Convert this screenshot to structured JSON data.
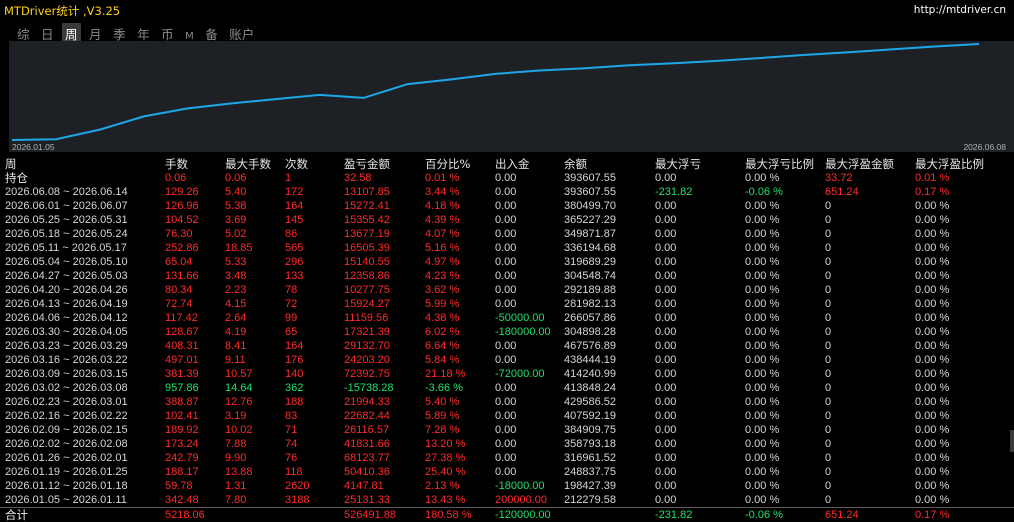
{
  "app": {
    "title": "MTDriver统计 ,V3.25",
    "link": "http://mtdriver.cn"
  },
  "tabs": [
    {
      "label": "综",
      "active": false
    },
    {
      "label": "日",
      "active": false
    },
    {
      "label": "周",
      "active": true
    },
    {
      "label": "月",
      "active": false
    },
    {
      "label": "季",
      "active": false
    },
    {
      "label": "年",
      "active": false
    },
    {
      "label": "币",
      "active": false
    },
    {
      "label": "M",
      "active": false
    },
    {
      "label": "备",
      "active": false
    },
    {
      "label": "账户",
      "active": false
    }
  ],
  "chart_data": {
    "type": "line",
    "x_start_label": "2026.01.05",
    "x_end_label": "2026.06.08",
    "line_color": "#1ea7e8",
    "background": "#1d2126",
    "grid": false,
    "x": [
      "2026.01.05",
      "2026.01.12",
      "2026.01.19",
      "2026.01.26",
      "2026.02.02",
      "2026.02.09",
      "2026.02.16",
      "2026.02.23",
      "2026.03.02",
      "2026.03.09",
      "2026.03.16",
      "2026.03.23",
      "2026.03.30",
      "2026.04.06",
      "2026.04.13",
      "2026.04.20",
      "2026.04.27",
      "2026.05.04",
      "2026.05.11",
      "2026.05.18",
      "2026.05.25",
      "2026.06.01",
      "2026.06.08"
    ],
    "values": [
      25131.33,
      29278.14,
      79688.5,
      148512.03,
      190353.99,
      216470.56,
      238953.4,
      260947.73,
      245209.45,
      317602.15,
      341805.15,
      370937.85,
      388259.24,
      399419.8,
      415344.07,
      425621.82,
      437980.68,
      453121.23,
      469626.42,
      483303.61,
      498659.03,
      513931.44,
      527039.29
    ]
  },
  "table": {
    "headers": [
      "周",
      "手数",
      "最大手数",
      "次数",
      "盈亏金额",
      "百分比%",
      "出入金",
      "余额",
      "最大浮亏",
      "最大浮亏比例",
      "最大浮盈金额",
      "最大浮盈比例"
    ],
    "hold": {
      "c": [
        "持仓",
        "0.06",
        "0.06",
        "1",
        "32.58",
        "0.01 %",
        "0.00",
        "393607.55",
        "0.00",
        "0.00 %",
        "33.72",
        "0.01 %"
      ],
      "k": [
        "w",
        "r",
        "r",
        "r",
        "r",
        "r",
        "g",
        "g",
        "g",
        "g",
        "r",
        "r"
      ]
    },
    "rows": [
      {
        "c": [
          "2026.06.08 ~ 2026.06.14",
          "129.26",
          "5.40",
          "172",
          "13107.85",
          "3.44 %",
          "0.00",
          "393607.55",
          "-231.82",
          "-0.06 %",
          "651.24",
          "0.17 %"
        ],
        "k": [
          "g",
          "r",
          "r",
          "r",
          "r",
          "r",
          "g",
          "g",
          "n",
          "n",
          "r",
          "r"
        ]
      },
      {
        "c": [
          "2026.06.01 ~ 2026.06.07",
          "126.96",
          "5.38",
          "164",
          "15272.41",
          "4.18 %",
          "0.00",
          "380499.70",
          "0.00",
          "0.00 %",
          "0",
          "0.00 %"
        ],
        "k": [
          "g",
          "r",
          "r",
          "r",
          "r",
          "r",
          "g",
          "g",
          "g",
          "g",
          "g",
          "g"
        ]
      },
      {
        "c": [
          "2026.05.25 ~ 2026.05.31",
          "104.52",
          "3.69",
          "145",
          "15355.42",
          "4.39 %",
          "0.00",
          "365227.29",
          "0.00",
          "0.00 %",
          "0",
          "0.00 %"
        ],
        "k": [
          "g",
          "r",
          "r",
          "r",
          "r",
          "r",
          "g",
          "g",
          "g",
          "g",
          "g",
          "g"
        ]
      },
      {
        "c": [
          "2026.05.18 ~ 2026.05.24",
          "76.30",
          "5.02",
          "86",
          "13677.19",
          "4.07 %",
          "0.00",
          "349871.87",
          "0.00",
          "0.00 %",
          "0",
          "0.00 %"
        ],
        "k": [
          "g",
          "r",
          "r",
          "r",
          "r",
          "r",
          "g",
          "g",
          "g",
          "g",
          "g",
          "g"
        ]
      },
      {
        "c": [
          "2026.05.11 ~ 2026.05.17",
          "252.86",
          "18.85",
          "565",
          "16505.39",
          "5.16 %",
          "0.00",
          "336194.68",
          "0.00",
          "0.00 %",
          "0",
          "0.00 %"
        ],
        "k": [
          "g",
          "r",
          "r",
          "r",
          "r",
          "r",
          "g",
          "g",
          "g",
          "g",
          "g",
          "g"
        ]
      },
      {
        "c": [
          "2026.05.04 ~ 2026.05.10",
          "65.04",
          "5.33",
          "296",
          "15140.55",
          "4.97 %",
          "0.00",
          "319689.29",
          "0.00",
          "0.00 %",
          "0",
          "0.00 %"
        ],
        "k": [
          "g",
          "r",
          "r",
          "r",
          "r",
          "r",
          "g",
          "g",
          "g",
          "g",
          "g",
          "g"
        ]
      },
      {
        "c": [
          "2026.04.27 ~ 2026.05.03",
          "131.66",
          "3.48",
          "133",
          "12358.86",
          "4.23 %",
          "0.00",
          "304548.74",
          "0.00",
          "0.00 %",
          "0",
          "0.00 %"
        ],
        "k": [
          "g",
          "r",
          "r",
          "r",
          "r",
          "r",
          "g",
          "g",
          "g",
          "g",
          "g",
          "g"
        ]
      },
      {
        "c": [
          "2026.04.20 ~ 2026.04.26",
          "80.34",
          "2.23",
          "78",
          "10277.75",
          "3.62 %",
          "0.00",
          "292189.88",
          "0.00",
          "0.00 %",
          "0",
          "0.00 %"
        ],
        "k": [
          "g",
          "r",
          "r",
          "r",
          "r",
          "r",
          "g",
          "g",
          "g",
          "g",
          "g",
          "g"
        ]
      },
      {
        "c": [
          "2026.04.13 ~ 2026.04.19",
          "72.74",
          "4.15",
          "72",
          "15924.27",
          "5.99 %",
          "0.00",
          "281982.13",
          "0.00",
          "0.00 %",
          "0",
          "0.00 %"
        ],
        "k": [
          "g",
          "r",
          "r",
          "r",
          "r",
          "r",
          "g",
          "g",
          "g",
          "g",
          "g",
          "g"
        ]
      },
      {
        "c": [
          "2026.04.06 ~ 2026.04.12",
          "117.42",
          "2.64",
          "99",
          "11159.56",
          "4.38 %",
          "-50000.00",
          "266057.86",
          "0.00",
          "0.00 %",
          "0",
          "0.00 %"
        ],
        "k": [
          "g",
          "r",
          "r",
          "r",
          "r",
          "r",
          "n",
          "g",
          "g",
          "g",
          "g",
          "g"
        ]
      },
      {
        "c": [
          "2026.03.30 ~ 2026.04.05",
          "128.67",
          "4.19",
          "65",
          "17321.39",
          "6.02 %",
          "-180000.00",
          "304898.28",
          "0.00",
          "0.00 %",
          "0",
          "0.00 %"
        ],
        "k": [
          "g",
          "r",
          "r",
          "r",
          "r",
          "r",
          "n",
          "g",
          "g",
          "g",
          "g",
          "g"
        ]
      },
      {
        "c": [
          "2026.03.23 ~ 2026.03.29",
          "408.31",
          "8.41",
          "164",
          "29132.70",
          "6.64 %",
          "0.00",
          "467576.89",
          "0.00",
          "0.00 %",
          "0",
          "0.00 %"
        ],
        "k": [
          "g",
          "r",
          "r",
          "r",
          "r",
          "r",
          "g",
          "g",
          "g",
          "g",
          "g",
          "g"
        ]
      },
      {
        "c": [
          "2026.03.16 ~ 2026.03.22",
          "497.01",
          "9.11",
          "176",
          "24203.20",
          "5.84 %",
          "0.00",
          "438444.19",
          "0.00",
          "0.00 %",
          "0",
          "0.00 %"
        ],
        "k": [
          "g",
          "r",
          "r",
          "r",
          "r",
          "r",
          "g",
          "g",
          "g",
          "g",
          "g",
          "g"
        ]
      },
      {
        "c": [
          "2026.03.09 ~ 2026.03.15",
          "381.39",
          "10.57",
          "140",
          "72392.75",
          "21.18 %",
          "-72000.00",
          "414240.99",
          "0.00",
          "0.00 %",
          "0",
          "0.00 %"
        ],
        "k": [
          "g",
          "r",
          "r",
          "r",
          "r",
          "r",
          "n",
          "g",
          "g",
          "g",
          "g",
          "g"
        ]
      },
      {
        "c": [
          "2026.03.02 ~ 2026.03.08",
          "957.86",
          "14.64",
          "362",
          "-15738.28",
          "-3.66 %",
          "0.00",
          "413848.24",
          "0.00",
          "0.00 %",
          "0",
          "0.00 %"
        ],
        "k": [
          "g",
          "n",
          "n",
          "n",
          "n",
          "n",
          "g",
          "g",
          "g",
          "g",
          "g",
          "g"
        ]
      },
      {
        "c": [
          "2026.02.23 ~ 2026.03.01",
          "388.87",
          "12.76",
          "188",
          "21994.33",
          "5.40 %",
          "0.00",
          "429586.52",
          "0.00",
          "0.00 %",
          "0",
          "0.00 %"
        ],
        "k": [
          "g",
          "r",
          "r",
          "r",
          "r",
          "r",
          "g",
          "g",
          "g",
          "g",
          "g",
          "g"
        ]
      },
      {
        "c": [
          "2026.02.16 ~ 2026.02.22",
          "102.41",
          "3.19",
          "83",
          "22682.44",
          "5.89 %",
          "0.00",
          "407592.19",
          "0.00",
          "0.00 %",
          "0",
          "0.00 %"
        ],
        "k": [
          "g",
          "r",
          "r",
          "r",
          "r",
          "r",
          "g",
          "g",
          "g",
          "g",
          "g",
          "g"
        ]
      },
      {
        "c": [
          "2026.02.09 ~ 2026.02.15",
          "189.92",
          "10.02",
          "71",
          "26116.57",
          "7.28 %",
          "0.00",
          "384909.75",
          "0.00",
          "0.00 %",
          "0",
          "0.00 %"
        ],
        "k": [
          "g",
          "r",
          "r",
          "r",
          "r",
          "r",
          "g",
          "g",
          "g",
          "g",
          "g",
          "g"
        ]
      },
      {
        "c": [
          "2026.02.02 ~ 2026.02.08",
          "173.24",
          "7.88",
          "74",
          "41831.66",
          "13.20 %",
          "0.00",
          "358793.18",
          "0.00",
          "0.00 %",
          "0",
          "0.00 %"
        ],
        "k": [
          "g",
          "r",
          "r",
          "r",
          "r",
          "r",
          "g",
          "g",
          "g",
          "g",
          "g",
          "g"
        ]
      },
      {
        "c": [
          "2026.01.26 ~ 2026.02.01",
          "242.79",
          "9.90",
          "76",
          "68123.77",
          "27.38 %",
          "0.00",
          "316961.52",
          "0.00",
          "0.00 %",
          "0",
          "0.00 %"
        ],
        "k": [
          "g",
          "r",
          "r",
          "r",
          "r",
          "r",
          "g",
          "g",
          "g",
          "g",
          "g",
          "g"
        ]
      },
      {
        "c": [
          "2026.01.19 ~ 2026.01.25",
          "188.17",
          "13.88",
          "118",
          "50410.36",
          "25.40 %",
          "0.00",
          "248837.75",
          "0.00",
          "0.00 %",
          "0",
          "0.00 %"
        ],
        "k": [
          "g",
          "r",
          "r",
          "r",
          "r",
          "r",
          "g",
          "g",
          "g",
          "g",
          "g",
          "g"
        ]
      },
      {
        "c": [
          "2026.01.12 ~ 2026.01.18",
          "59.78",
          "1.31",
          "2620",
          "4147.81",
          "2.13 %",
          "-18000.00",
          "198427.39",
          "0.00",
          "0.00 %",
          "0",
          "0.00 %"
        ],
        "k": [
          "g",
          "r",
          "r",
          "r",
          "r",
          "r",
          "n",
          "g",
          "g",
          "g",
          "g",
          "g"
        ]
      },
      {
        "c": [
          "2026.01.05 ~ 2026.01.11",
          "342.48",
          "7.80",
          "3188",
          "25131.33",
          "13.43 %",
          "200000.00",
          "212279.58",
          "0.00",
          "0.00 %",
          "0",
          "0.00 %"
        ],
        "k": [
          "g",
          "r",
          "r",
          "r",
          "r",
          "r",
          "r",
          "g",
          "g",
          "g",
          "g",
          "g"
        ]
      }
    ],
    "total": {
      "c": [
        "合计",
        "5218.06",
        "",
        "",
        "526491.88",
        "180.58 %",
        "-120000.00",
        "",
        "-231.82",
        "-0.06 %",
        "651.24",
        "0.17 %"
      ],
      "k": [
        "w",
        "r",
        "r",
        "r",
        "r",
        "r",
        "n",
        "g",
        "n",
        "n",
        "r",
        "r"
      ]
    }
  },
  "colors": {
    "profit": "#ff2a2a",
    "loss": "#1fe26a",
    "neutral": "#d6d6d6",
    "title": "#ffd21a",
    "chart_line": "#1ea7e8"
  }
}
